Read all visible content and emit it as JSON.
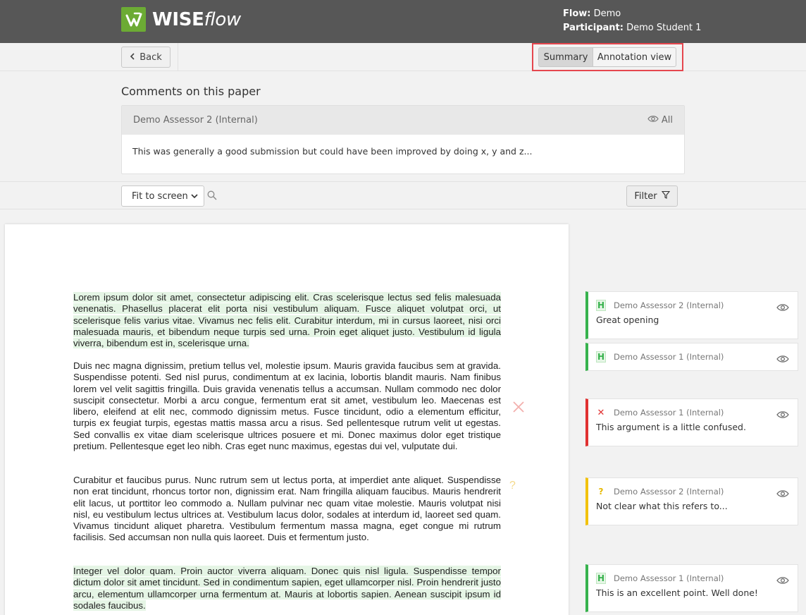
{
  "header": {
    "brand_strong": "WISE",
    "brand_light": "flow",
    "flow_label": "Flow:",
    "flow_value": "Demo",
    "participant_label": "Participant:",
    "participant_value": "Demo Student 1"
  },
  "toolbar": {
    "back_label": "Back",
    "summary_label": "Summary",
    "annotation_label": "Annotation view"
  },
  "comments": {
    "title": "Comments on this paper",
    "author": "Demo Assessor 2 (Internal)",
    "visibility": "All",
    "text": "This was generally a good submission but could have been improved by doing x, y and z..."
  },
  "toolbar2": {
    "zoom_value": "Fit to screen",
    "filter_label": "Filter"
  },
  "paper": {
    "p1": "Lorem ipsum dolor sit amet, consectetur adipiscing elit. Cras scelerisque lectus sed felis malesuada venenatis. Phasellus placerat elit porta nisi vestibulum aliquam. Fusce aliquet volutpat orci, ut scelerisque felis varius vitae. Vivamus nec felis elit. Curabitur interdum, mi in cursus laoreet, nisi orci malesuada mauris, et bibendum neque turpis sed urna. Proin eget aliquet justo. Vestibulum id ligula viverra, bibendum est in, scelerisque urna.",
    "p2": "Duis nec magna dignissim, pretium tellus vel, molestie ipsum. Mauris gravida faucibus sem at gravida. Suspendisse potenti. Sed nisl purus, condimentum at ex lacinia, lobortis blandit mauris. Nam finibus lorem vel velit sagittis fringilla. Duis gravida venenatis tellus a accumsan. Nullam commodo nec dolor suscipit consectetur. Morbi a arcu congue, fermentum erat sit amet, vestibulum leo. Maecenas est libero, eleifend at elit nec, commodo dignissim metus. Fusce tincidunt, odio a elementum efficitur, turpis ex feugiat turpis, egestas mattis massa arcu a risus. Sed pellentesque rutrum velit ut egestas. Sed convallis ex vitae diam scelerisque ultrices posuere et mi. Donec maximus dolor eget tristique pretium. Pellentesque eget leo nibh. Cras eget nunc maximus, egestas dui vel, vulputate dui.",
    "p3": "Curabitur et faucibus purus. Nunc rutrum sem ut lectus porta, at imperdiet ante aliquet. Suspendisse non erat tincidunt, rhoncus tortor non, dignissim erat. Nam fringilla aliquam faucibus. Mauris hendrerit elit lacus, ut porttitor leo commodo a. Nullam pulvinar nec quam vitae molestie. Mauris volutpat nisi nisl, eu vestibulum lectus ultrices at. Vestibulum lacus dolor, sodales at interdum id, laoreet sed quam. Vivamus tincidunt aliquet pharetra. Vestibulum fermentum massa magna, eget congue mi rutrum facilisis. Sed accumsan non nulla quis laoreet. Duis et fermentum justo.",
    "p4": "Integer vel dolor quam. Proin auctor viverra aliquam. Donec quis nisl ligula. Suspendisse tempor dictum dolor sit amet tincidunt. Sed in condimentum sapien, eget ullamcorper nisl. Proin hendrerit justo arcu, elementum ullamcorper urna fermentum at. Mauris at lobortis sapien. Aenean suscipit ipsum id sodales faucibus.",
    "question_mark": "?"
  },
  "annotations": [
    {
      "type_glyph": "H",
      "author": "Demo Assessor 2 (Internal)",
      "text": "Great opening"
    },
    {
      "type_glyph": "H",
      "author": "Demo Assessor 1 (Internal)",
      "text": ""
    },
    {
      "type_glyph": "✕",
      "author": "Demo Assessor 1 (Internal)",
      "text": "This argument is a little confused."
    },
    {
      "type_glyph": "?",
      "author": "Demo Assessor 2 (Internal)",
      "text": "Not clear what this refers to..."
    },
    {
      "type_glyph": "H",
      "author": "Demo Assessor 1 (Internal)",
      "text": "This is an excellent point. Well done!"
    }
  ],
  "colors": {
    "header_bg": "#575757",
    "brand_green": "#6cab34",
    "highlight_bg": "#e5f5e5",
    "toggle_outline": "#e5464e",
    "positive": "#37b24d",
    "negative": "#e03131",
    "question": "#f2c20e"
  }
}
